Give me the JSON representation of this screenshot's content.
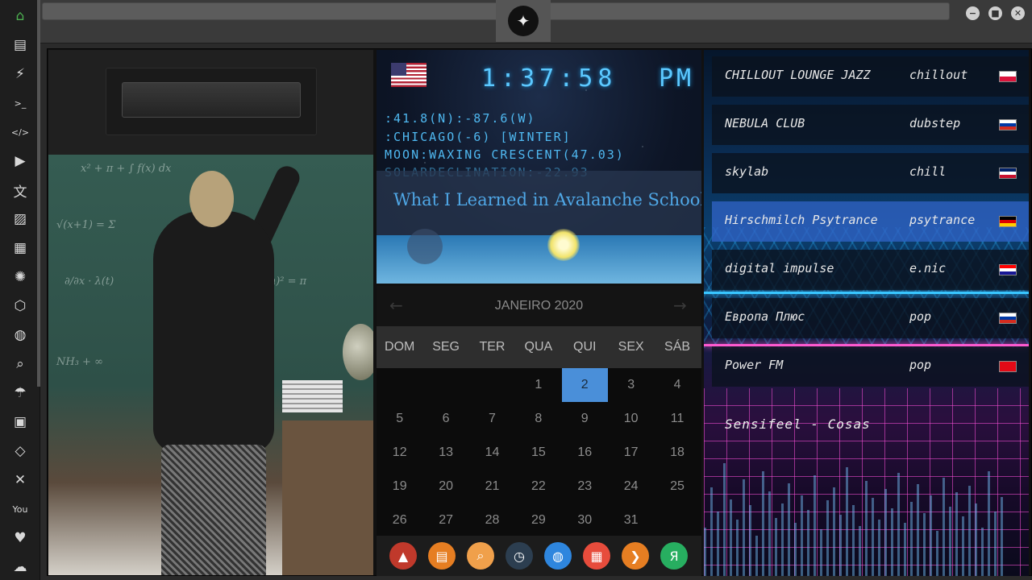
{
  "sidebar": {
    "items": [
      {
        "icon": "home-icon",
        "glyph": "⌂",
        "active": true
      },
      {
        "icon": "document-icon",
        "glyph": "▤"
      },
      {
        "icon": "lightning-icon",
        "glyph": "⚡"
      },
      {
        "icon": "terminal-icon",
        "glyph": ">_"
      },
      {
        "icon": "code-icon",
        "glyph": "</>"
      },
      {
        "icon": "play-icon",
        "glyph": "▶"
      },
      {
        "icon": "translate-icon",
        "glyph": "文"
      },
      {
        "icon": "image-icon",
        "glyph": "▨"
      },
      {
        "icon": "news-icon",
        "glyph": "▦"
      },
      {
        "icon": "rebel-icon",
        "glyph": "✺"
      },
      {
        "icon": "hexagon-icon",
        "glyph": "⬡"
      },
      {
        "icon": "globe-icon",
        "glyph": "◍"
      },
      {
        "icon": "search-icon",
        "glyph": "⌕"
      },
      {
        "icon": "umbrella-icon",
        "glyph": "☂"
      },
      {
        "icon": "contact-icon",
        "glyph": "▣"
      },
      {
        "icon": "diamond-code-icon",
        "glyph": "◇"
      },
      {
        "icon": "expand-icon",
        "glyph": "✕"
      },
      {
        "icon": "youtube-icon",
        "glyph": "You"
      },
      {
        "icon": "heart-icon",
        "glyph": "♥"
      },
      {
        "icon": "cloud-icon",
        "glyph": "☁"
      }
    ]
  },
  "window": {
    "minimize": "−",
    "maximize": "■",
    "close": "✕",
    "logo": "✦"
  },
  "clock": {
    "time": "1:37:58",
    "ampm": "PM",
    "coords": ":41.8(N):-87.6(W)",
    "location": ":CHICAGO(-6) [WINTER]",
    "moon": "MOON:WAXING CRESCENT(47.03)",
    "solar": "SOLARDECLINATION:-22.93",
    "headline": "What I Learned in Avalanche School"
  },
  "calendar": {
    "month": "JANEIRO 2020",
    "prev": "←",
    "next": "→",
    "weekdays": [
      "DOM",
      "SEG",
      "TER",
      "QUA",
      "QUI",
      "SEX",
      "SÁB"
    ],
    "days": [
      "",
      "",
      "",
      "1",
      "2",
      "3",
      "4",
      "5",
      "6",
      "7",
      "8",
      "9",
      "10",
      "11",
      "12",
      "13",
      "14",
      "15",
      "16",
      "17",
      "18",
      "19",
      "20",
      "21",
      "22",
      "23",
      "24",
      "25",
      "26",
      "27",
      "28",
      "29",
      "30",
      "31"
    ],
    "today": "2"
  },
  "dock": {
    "items": [
      {
        "icon": "app-launcher-icon",
        "glyph": "▲",
        "color": "#c0392b"
      },
      {
        "icon": "news-reader-icon",
        "glyph": "▤",
        "color": "#e67e22"
      },
      {
        "icon": "search-app-icon",
        "glyph": "⌕",
        "color": "#f0a04b"
      },
      {
        "icon": "clock-app-icon",
        "glyph": "◷",
        "color": "#2c3e50"
      },
      {
        "icon": "browser-icon",
        "glyph": "◍",
        "color": "#2e86de"
      },
      {
        "icon": "calendar-app-icon",
        "glyph": "▦",
        "color": "#e74c3c"
      },
      {
        "icon": "arrow-app-icon",
        "glyph": "❯",
        "color": "#e67e22"
      },
      {
        "icon": "yandex-icon",
        "glyph": "Я",
        "color": "#27ae60"
      }
    ]
  },
  "radio": {
    "stations": [
      {
        "name": "CHILLOUT LOUNGE JAZZ",
        "genre": "chillout",
        "flag": "poland-flag-icon",
        "flag_colors": [
          "#ffffff",
          "#dc143c"
        ]
      },
      {
        "name": "NEBULA CLUB",
        "genre": "dubstep",
        "flag": "russia-flag-icon",
        "flag_colors": [
          "#ffffff",
          "#0039a6",
          "#d52b1e"
        ]
      },
      {
        "name": "skylab",
        "genre": "chill",
        "flag": "uk-flag-icon",
        "flag_colors": [
          "#012169",
          "#ffffff",
          "#c8102e"
        ]
      },
      {
        "name": "Hirschmilch Psytrance",
        "genre": "psytrance",
        "flag": "germany-flag-icon",
        "flag_colors": [
          "#000000",
          "#dd0000",
          "#ffce00"
        ],
        "active": true
      },
      {
        "name": "digital impulse",
        "genre": "e.nic",
        "flag": "croatia-flag-icon",
        "flag_colors": [
          "#ff0000",
          "#ffffff",
          "#171796"
        ]
      },
      {
        "name": "Европа Плюс",
        "genre": "pop",
        "flag": "russia-flag-icon",
        "flag_colors": [
          "#ffffff",
          "#0039a6",
          "#d52b1e"
        ]
      },
      {
        "name": "Power FM",
        "genre": "pop",
        "flag": "turkey-flag-icon",
        "flag_colors": [
          "#e30a17",
          "#e30a17",
          "#e30a17"
        ]
      }
    ],
    "now_playing": "Sensifeel - Cosas"
  }
}
